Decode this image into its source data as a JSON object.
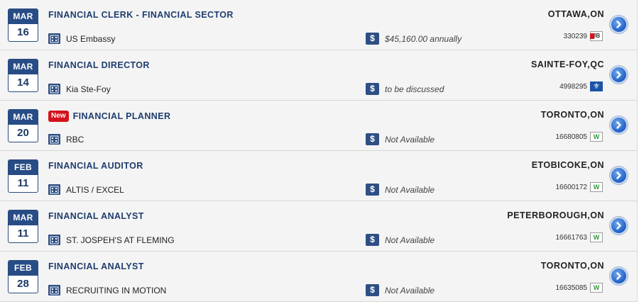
{
  "jobs": [
    {
      "month": "MAR",
      "day": "16",
      "title": "FINANCIAL CLERK - FINANCIAL SECTOR",
      "is_new": false,
      "new_label": "",
      "company": "US Embassy",
      "salary": "$45,160.00 annually",
      "location": "OTTAWA,ON",
      "ref": "330239",
      "source_icon": "jb-icon",
      "source_text": "JB"
    },
    {
      "month": "MAR",
      "day": "14",
      "title": "FINANCIAL DIRECTOR",
      "is_new": false,
      "new_label": "",
      "company": "Kia Ste-Foy",
      "salary": "to be discussed",
      "location": "SAINTE-FOY,QC",
      "ref": "4998295",
      "source_icon": "quebec-fleurdelis-icon",
      "source_text": "⚜"
    },
    {
      "month": "MAR",
      "day": "20",
      "title": "FINANCIAL PLANNER",
      "is_new": true,
      "new_label": "New",
      "company": "RBC",
      "salary": "Not Available",
      "location": "TORONTO,ON",
      "ref": "16680805",
      "source_icon": "workopolis-icon",
      "source_text": "W"
    },
    {
      "month": "FEB",
      "day": "11",
      "title": "FINANCIAL AUDITOR",
      "is_new": false,
      "new_label": "",
      "company": "ALTIS / EXCEL",
      "salary": "Not Available",
      "location": "ETOBICOKE,ON",
      "ref": "16600172",
      "source_icon": "workopolis-icon",
      "source_text": "W"
    },
    {
      "month": "MAR",
      "day": "11",
      "title": "FINANCIAL ANALYST",
      "is_new": false,
      "new_label": "",
      "company": "ST. JOSPEH'S AT FLEMING",
      "salary": "Not Available",
      "location": "PETERBOROUGH,ON",
      "ref": "16661763",
      "source_icon": "workopolis-icon",
      "source_text": "W"
    },
    {
      "month": "FEB",
      "day": "28",
      "title": "FINANCIAL ANALYST",
      "is_new": false,
      "new_label": "",
      "company": "RECRUITING IN MOTION",
      "salary": "Not Available",
      "location": "TORONTO,ON",
      "ref": "16635085",
      "source_icon": "workopolis-icon",
      "source_text": "W"
    }
  ],
  "icons": {
    "company": "building-icon",
    "salary": "dollar-icon",
    "details": "chevron-right-icon"
  },
  "colors": {
    "accent": "#274c86",
    "new_badge": "#d4121c",
    "row_bg": "#f4f4f4"
  }
}
